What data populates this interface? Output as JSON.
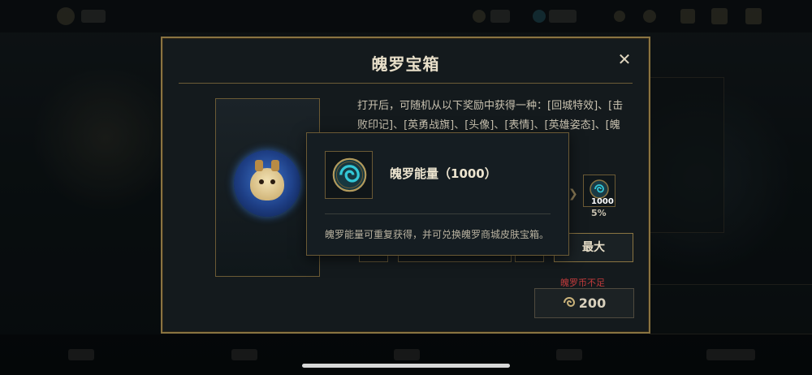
{
  "modal": {
    "title": "魄罗宝箱",
    "close_label": "✕",
    "description": "打开后，可随机从以下奖励中获得一种：[回城特效]、[击败印记]、[英勇战旗]、[头像]、[表情]、[英雄姿态]、[魄罗能",
    "reward": {
      "quantity": "1000",
      "chance": "5%"
    },
    "max_label": "最大",
    "warning": "魄罗币不足",
    "price": "200"
  },
  "tooltip": {
    "title": "魄罗能量（1000）",
    "description": "魄罗能量可重复获得，并可兑换魄罗商城皮肤宝箱。"
  },
  "colors": {
    "gold_border": "#8a7441",
    "warning": "#c23b3b",
    "swirl_teal": "#33c7d6"
  }
}
